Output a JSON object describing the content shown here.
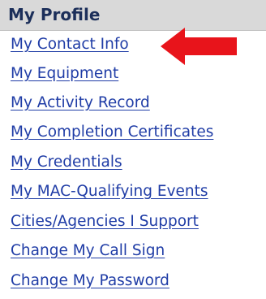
{
  "header": {
    "title": "My Profile"
  },
  "menu": {
    "items": [
      {
        "label": "My Contact Info"
      },
      {
        "label": "My Equipment"
      },
      {
        "label": "My Activity Record"
      },
      {
        "label": "My Completion Certificates"
      },
      {
        "label": "My Credentials"
      },
      {
        "label": "My MAC-Qualifying Events"
      },
      {
        "label": "Cities/Agencies I Support"
      },
      {
        "label": "Change My Call Sign"
      },
      {
        "label": "Change My Password"
      }
    ]
  },
  "annotation": {
    "arrow_color": "#e8141b",
    "arrow_icon": "left-arrow-icon"
  },
  "colors": {
    "header_bg": "#d9d9d9",
    "header_text": "#1c2f5a",
    "link": "#1f3ca6"
  }
}
